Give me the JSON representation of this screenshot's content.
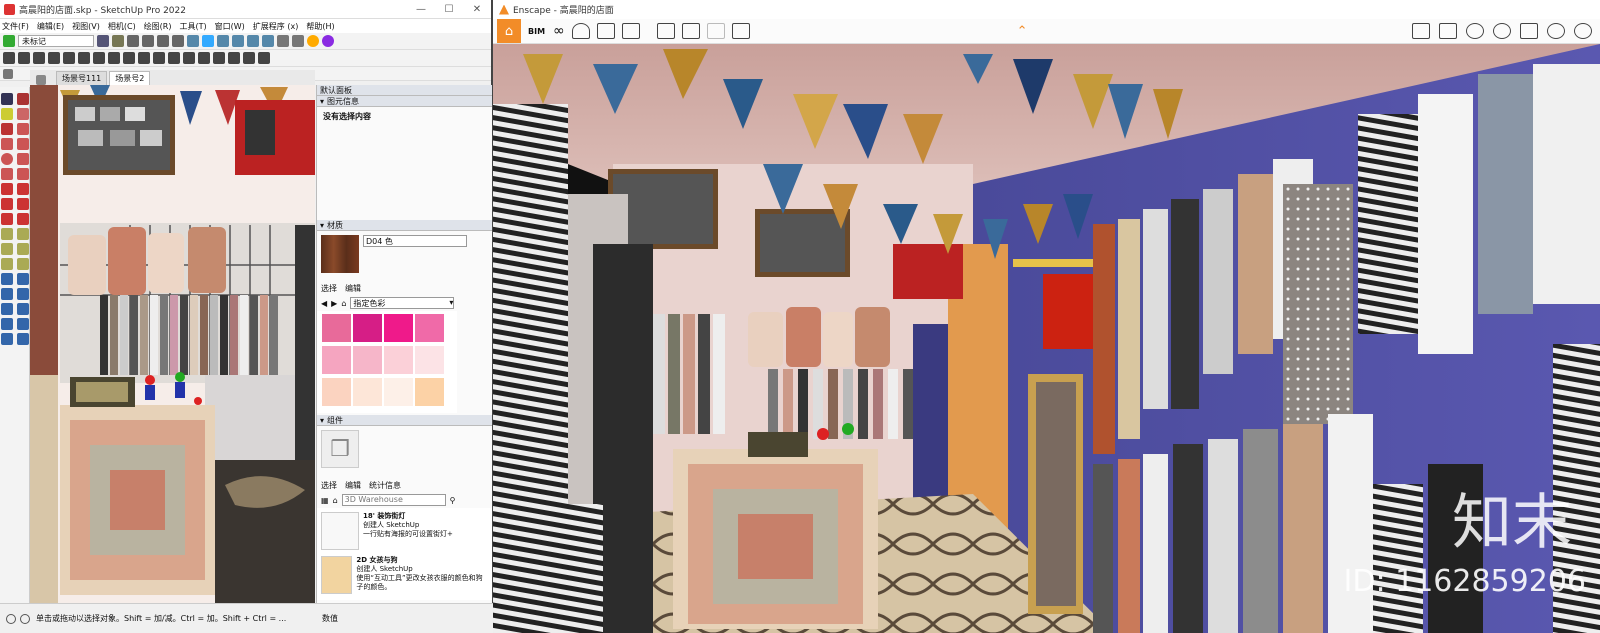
{
  "sketchup": {
    "title": "高晨阳的店面.skp - SketchUp Pro 2022",
    "window_controls": [
      "—",
      "☐",
      "✕"
    ],
    "menu": [
      "文件(F)",
      "编辑(E)",
      "视图(V)",
      "相机(C)",
      "绘图(R)",
      "工具(T)",
      "窗口(W)",
      "扩展程序 (x)",
      "帮助(H)"
    ],
    "tag_select": "未标记",
    "scene_tabs": [
      "场景号111",
      "场景号2"
    ],
    "panel": {
      "tray_title": "默认面板",
      "entity_info_header": "图元信息",
      "entity_info_text": "没有选择内容",
      "materials_header": "材质",
      "material_name": "D04 色",
      "materials_tabs": [
        "选择",
        "编辑"
      ],
      "color_dropdown": "指定色彩",
      "components_header": "组件",
      "components_tabs": [
        "选择",
        "编辑",
        "统计信息"
      ],
      "search_placeholder": "3D Warehouse",
      "items": [
        {
          "title": "18' 装饰街灯",
          "author": "创建人 SketchUp",
          "desc": "一行贴有海报的可设置街灯+"
        },
        {
          "title": "2D 女孩与狗",
          "author": "创建人 SketchUp",
          "desc": "使用“互动工具”更改女孩衣服的颜色和狗子的颜色。"
        }
      ]
    },
    "status_text": "单击或拖动以选择对象。Shift = 加/减。Ctrl = 加。Shift + Ctrl = ...",
    "value_label": "数值"
  },
  "enscape": {
    "title": "Enscape - 高晨阳的店面",
    "toolbar_icons": [
      "home-icon",
      "bim-icon",
      "binoculars-icon",
      "asset-library-icon",
      "buildings-icon",
      "clapper-icon",
      "screenshot-icon",
      "batch-render-icon",
      "export-icon",
      "settings-icon"
    ],
    "bim_label": "BIM"
  },
  "watermark": {
    "brand": "知末",
    "id": "ID: 1162859206"
  },
  "colors": {
    "enscape_orange": "#f28c28",
    "sketchup_red": "#d33",
    "swatches": [
      "#e86a9a",
      "#d61e86",
      "#ef1a8a",
      "#f06aa8",
      "#f5a5c0",
      "#f6b6c9",
      "#fbd0d8",
      "#fce3e6",
      "#fbd3c0",
      "#fde6d8",
      "#fdf0e8",
      "#fcd2a6"
    ]
  }
}
